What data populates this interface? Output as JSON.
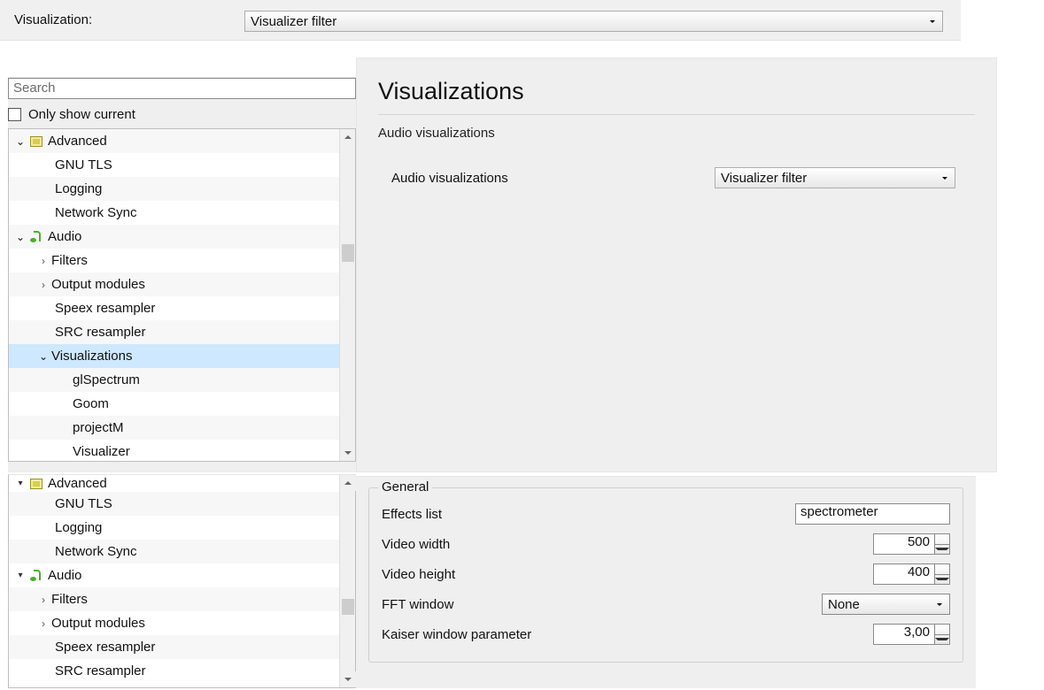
{
  "topbar": {
    "vis_label": "Visualization:",
    "vis_select": "Visualizer filter"
  },
  "search": {
    "placeholder": "Search"
  },
  "only_current": "Only show current",
  "tree": {
    "advanced": "Advanced",
    "gnu_tls": "GNU TLS",
    "logging": "Logging",
    "network_sync": "Network Sync",
    "audio": "Audio",
    "filters": "Filters",
    "output_modules": "Output modules",
    "speex": "Speex resampler",
    "src": "SRC resampler",
    "visualizations": "Visualizations",
    "gl": "glSpectrum",
    "goom": "Goom",
    "projectm": "projectM",
    "visualizer": "Visualizer"
  },
  "right": {
    "title": "Visualizations",
    "subhead": "Audio visualizations",
    "param_label": "Audio visualizations",
    "param_select": "Visualizer filter"
  },
  "form": {
    "group": "General",
    "effects": "Effects list",
    "effects_val": "spectrometer",
    "vwidth": "Video width",
    "vwidth_val": "500",
    "vheight": "Video height",
    "vheight_val": "400",
    "fft": "FFT window",
    "fft_val": "None",
    "kaiser": "Kaiser window parameter",
    "kaiser_val": "3,00"
  }
}
